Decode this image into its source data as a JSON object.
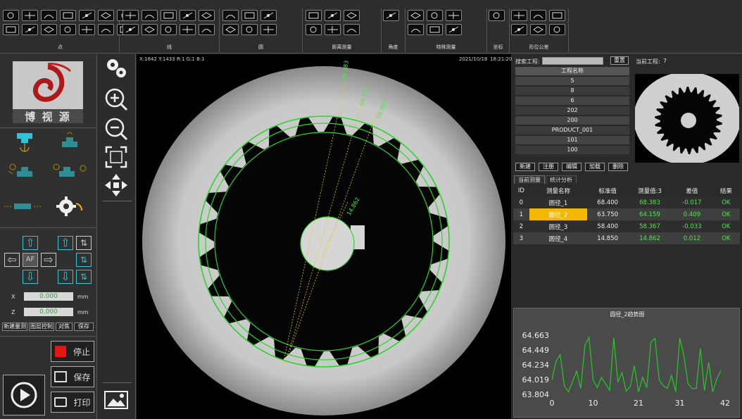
{
  "toolbar": {
    "groups": [
      {
        "label": "点"
      },
      {
        "label": "线"
      },
      {
        "label": "圆"
      },
      {
        "label": "距离测量"
      },
      {
        "label": "角度"
      },
      {
        "label": "特殊测量"
      },
      {
        "label": "坐标"
      },
      {
        "label": "形位公差"
      }
    ]
  },
  "left": {
    "logo_text": "博 视 源",
    "x_label": "X",
    "x_value": "0.000",
    "x_unit": "mm",
    "z_label": "Z",
    "z_value": "0.000",
    "z_unit": "mm",
    "af_label": "AF",
    "buttons": [
      "新建量测",
      "图层控制",
      "对焦",
      "保存"
    ],
    "stop_label": "停止",
    "save_label": "保存",
    "print_label": "打印"
  },
  "viewport": {
    "status_left": "X:1842  Y:1433  R:1  G:1  B:1",
    "date": "2021/10/18",
    "time": "18:21:20",
    "dim_labels": [
      "68.383",
      "64.159",
      "58.367",
      "14.862"
    ]
  },
  "right": {
    "search_label": "搜索工程:",
    "search_value": "",
    "reset_label": "重置",
    "current_project_label": "当前工程:",
    "current_project_value": "7",
    "project_header": "工程名称",
    "projects": [
      "5",
      "8",
      "6",
      "202",
      "200",
      "PRODUCT_001",
      "101",
      "100"
    ],
    "project_buttons": [
      "新建",
      "注册",
      "编辑",
      "加载",
      "删除"
    ],
    "tabs": [
      "当前测量",
      "统计分析"
    ],
    "table_headers": [
      "ID",
      "测量名称",
      "标准值",
      "测量值:3",
      "差值",
      "结果"
    ],
    "rows": [
      {
        "id": "0",
        "name": "圆径_1",
        "std": "68.400",
        "meas": "68.383",
        "diff": "-0.017",
        "result": "OK"
      },
      {
        "id": "1",
        "name": "圆径_2",
        "std": "63.750",
        "meas": "64.159",
        "diff": "0.409",
        "result": "OK"
      },
      {
        "id": "2",
        "name": "圆径_3",
        "std": "58.400",
        "meas": "58.367",
        "diff": "-0.033",
        "result": "OK"
      },
      {
        "id": "3",
        "name": "圆径_4",
        "std": "14.850",
        "meas": "14.862",
        "diff": "0.012",
        "result": "OK"
      }
    ],
    "selected_row": 1,
    "colors": {
      "selected": "#f5b800",
      "ok": "#4de84d"
    }
  },
  "chart_data": {
    "type": "line",
    "title": "圆径_2趋势图",
    "y_ticks": [
      "64.663",
      "64.449",
      "64.234",
      "64.019",
      "63.804"
    ],
    "x_ticks": [
      "0",
      "10",
      "21",
      "31",
      "42"
    ],
    "ylim": [
      63.804,
      64.663
    ],
    "xlim": [
      0,
      42
    ],
    "series": [
      {
        "x": [
          0,
          1,
          2,
          3,
          4,
          5,
          6,
          7,
          8,
          9,
          10,
          11,
          12,
          13,
          14,
          15,
          16,
          17,
          18,
          19,
          20,
          21,
          22,
          23,
          24,
          25,
          26,
          27,
          28,
          29,
          30,
          31,
          32,
          33,
          34,
          35,
          36,
          37,
          38,
          39,
          40,
          41
        ],
        "values": [
          64.02,
          64.28,
          64.38,
          63.93,
          63.84,
          63.99,
          64.14,
          63.89,
          64.52,
          64.63,
          64.01,
          63.9,
          64.05,
          63.96,
          63.86,
          64.63,
          63.98,
          64.12,
          63.85,
          63.92,
          64.22,
          63.84,
          64.05,
          63.9,
          64.56,
          64.62,
          64.02,
          63.93,
          63.89,
          64.08,
          63.84,
          64.62,
          64.37,
          63.96,
          63.89,
          63.89,
          64.47,
          63.86,
          64.27,
          63.84,
          64.03,
          64.15
        ]
      }
    ],
    "line_color": "#22cc22"
  }
}
